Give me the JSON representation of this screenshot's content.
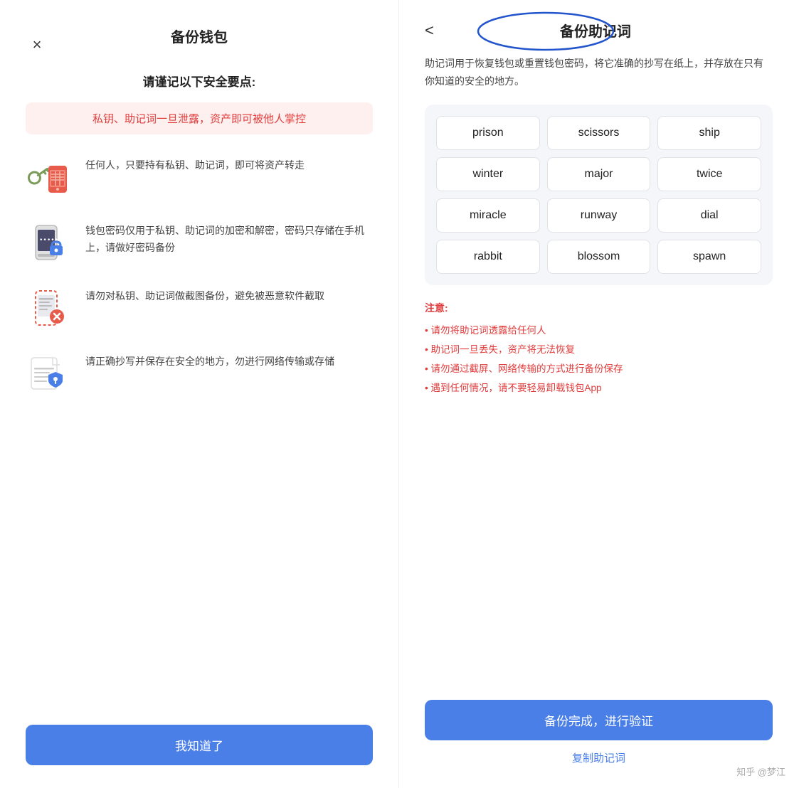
{
  "left": {
    "close_icon": "×",
    "title": "备份钱包",
    "security_heading": "请谨记以下安全要点:",
    "warning_text": "私钥、助记词一旦泄露，资产即可被他人掌控",
    "items": [
      {
        "icon": "key-phone",
        "text": "任何人，只要持有私钥、助记词，即可将资产转走"
      },
      {
        "icon": "phone-lock",
        "text": "钱包密码仅用于私钥、助记词的加密和解密，密码只存储在手机上，请做好密码备份"
      },
      {
        "icon": "phone-screenshot",
        "text": "请勿对私钥、助记词做截图备份，避免被恶意软件截取"
      },
      {
        "icon": "doc-secure",
        "text": "请正确抄写并保存在安全的地方，勿进行网络传输或存储"
      }
    ],
    "confirm_button": "我知道了"
  },
  "right": {
    "back_icon": "<",
    "title": "备份助记词",
    "description": "助记词用于恢复钱包或重置钱包密码，将它准确的抄写在纸上，并存放在只有你知道的安全的地方。",
    "mnemonic_words": [
      "prison",
      "scissors",
      "ship",
      "winter",
      "major",
      "twice",
      "miracle",
      "runway",
      "dial",
      "rabbit",
      "blossom",
      "spawn"
    ],
    "notes_title": "注意:",
    "notes": [
      "• 请勿将助记词透露给任何人",
      "• 助记词一旦丢失，资产将无法恢复",
      "• 请勿通过截屏、网络传输的方式进行备份保存",
      "• 遇到任何情况，请不要轻易卸载钱包App"
    ],
    "backup_button": "备份完成，进行验证",
    "copy_link": "复制助记词",
    "watermark": "知乎 @梦江"
  }
}
